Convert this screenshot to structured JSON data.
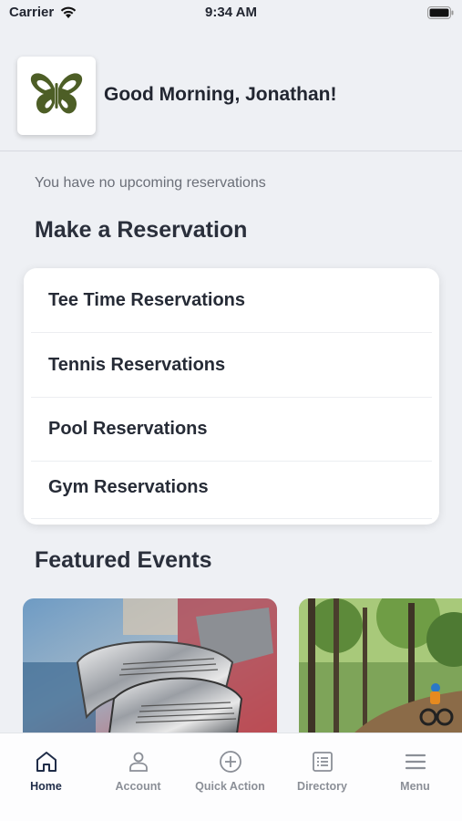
{
  "status_bar": {
    "carrier": "Carrier",
    "time": "9:34 AM"
  },
  "header": {
    "greeting": "Good Morning, Jonathan!",
    "logo_color": "#4d5e26"
  },
  "reservations": {
    "empty_message": "You have no upcoming reservations",
    "title": "Make a Reservation",
    "items": [
      {
        "label": "Tee Time Reservations"
      },
      {
        "label": "Tennis Reservations"
      },
      {
        "label": "Pool Reservations"
      },
      {
        "label": "Gym Reservations"
      }
    ]
  },
  "events": {
    "title": "Featured Events",
    "cards": [
      {
        "image": "golf-clubs-image"
      },
      {
        "image": "forest-cyclist-image"
      }
    ]
  },
  "tab_bar": {
    "tabs": [
      {
        "label": "Home",
        "icon": "home-icon",
        "active": true
      },
      {
        "label": "Account",
        "icon": "account-icon",
        "active": false
      },
      {
        "label": "Quick Action",
        "icon": "plus-circle-icon",
        "active": false
      },
      {
        "label": "Directory",
        "icon": "list-icon",
        "active": false
      },
      {
        "label": "Menu",
        "icon": "hamburger-icon",
        "active": false
      }
    ],
    "active_color": "#1f2c48",
    "inactive_color": "#8b8f97"
  }
}
